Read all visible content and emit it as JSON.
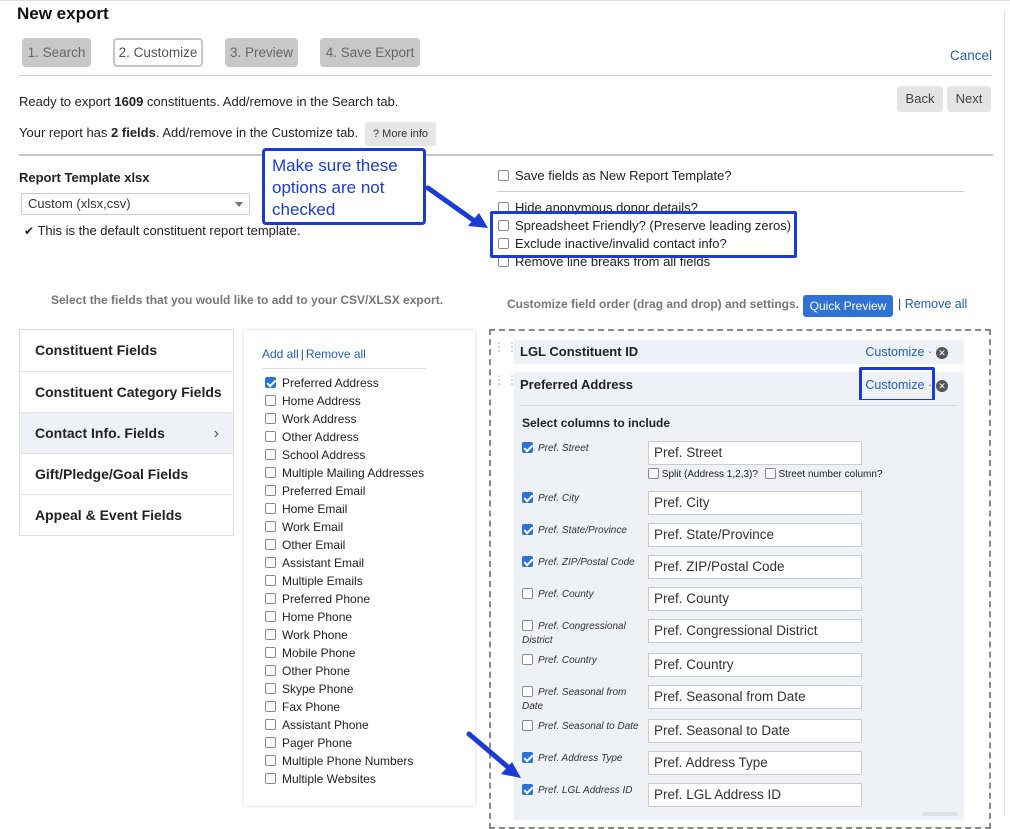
{
  "header": {
    "title": "New export"
  },
  "steps": [
    {
      "label": "1. Search"
    },
    {
      "label": "2. Customize"
    },
    {
      "label": "3. Preview"
    },
    {
      "label": "4. Save Export"
    }
  ],
  "cancel_label": "Cancel",
  "summary": {
    "line1_pre": "Ready to export ",
    "line1_count": "1609",
    "line1_post": " constituents. Add/remove in the Search tab.",
    "line2_pre": "Your report has ",
    "line2_count": "2 fields",
    "line2_post": ". Add/remove in the Customize tab.",
    "more_info": "? More info"
  },
  "nav": {
    "back": "Back",
    "next": "Next"
  },
  "template": {
    "label": "Report Template xlsx",
    "selected": "Custom (xlsx,csv)",
    "default_note": "This is the default constituent report template."
  },
  "options": [
    {
      "label": "Save fields as New Report Template?",
      "checked": false
    },
    {
      "label": "Hide anonymous donor details?",
      "checked": false
    },
    {
      "label": "Spreadsheet Friendly? (Preserve leading zeros)",
      "checked": false
    },
    {
      "label": "Exclude inactive/invalid contact info?",
      "checked": false
    },
    {
      "label": "Remove line breaks from all fields",
      "checked": false
    }
  ],
  "callout_text": "Make sure these options are not checked",
  "left_heading": "Select the fields that you would like to add to your CSV/XLSX export.",
  "right_heading": "Customize field order (drag and drop) and settings.",
  "quick_preview": "Quick Preview",
  "remove_all": "Remove all",
  "categories": [
    {
      "label": "Constituent Fields"
    },
    {
      "label": "Constituent Category Fields"
    },
    {
      "label": "Contact Info. Fields"
    },
    {
      "label": "Gift/Pledge/Goal Fields"
    },
    {
      "label": "Appeal & Event Fields"
    }
  ],
  "field_links": {
    "add_all": "Add all",
    "remove_all": "Remove all"
  },
  "fields": [
    {
      "label": "Preferred Address",
      "checked": true
    },
    {
      "label": "Home Address",
      "checked": false
    },
    {
      "label": "Work Address",
      "checked": false
    },
    {
      "label": "Other Address",
      "checked": false
    },
    {
      "label": "School Address",
      "checked": false
    },
    {
      "label": "Multiple Mailing Addresses",
      "checked": false
    },
    {
      "label": "Preferred Email",
      "checked": false
    },
    {
      "label": "Home Email",
      "checked": false
    },
    {
      "label": "Work Email",
      "checked": false
    },
    {
      "label": "Other Email",
      "checked": false
    },
    {
      "label": "Assistant Email",
      "checked": false
    },
    {
      "label": "Multiple Emails",
      "checked": false
    },
    {
      "label": "Preferred Phone",
      "checked": false
    },
    {
      "label": "Home Phone",
      "checked": false
    },
    {
      "label": "Work Phone",
      "checked": false
    },
    {
      "label": "Mobile Phone",
      "checked": false
    },
    {
      "label": "Other Phone",
      "checked": false
    },
    {
      "label": "Skype Phone",
      "checked": false
    },
    {
      "label": "Fax Phone",
      "checked": false
    },
    {
      "label": "Assistant Phone",
      "checked": false
    },
    {
      "label": "Pager Phone",
      "checked": false
    },
    {
      "label": "Multiple Phone Numbers",
      "checked": false
    },
    {
      "label": "Multiple Websites",
      "checked": false
    }
  ],
  "selected_fields": [
    {
      "title": "LGL Constituent ID",
      "customize": "Customize"
    },
    {
      "title": "Preferred Address",
      "customize": "Customize"
    }
  ],
  "columns_heading": "Select columns to include",
  "split_options": {
    "split": "Split (Address 1,2,3)?",
    "street_number": "Street number column?"
  },
  "columns": [
    {
      "label": "Pref. Street",
      "value": "Pref. Street",
      "checked": true
    },
    {
      "label": "Pref. City",
      "value": "Pref. City",
      "checked": true
    },
    {
      "label": "Pref. State/Province",
      "value": "Pref. State/Province",
      "checked": true
    },
    {
      "label": "Pref. ZIP/Postal Code",
      "value": "Pref. ZIP/Postal Code",
      "checked": true
    },
    {
      "label": "Pref. County",
      "value": "Pref. County",
      "checked": false
    },
    {
      "label": "Pref. Congressional District",
      "value": "Pref. Congressional District",
      "checked": false
    },
    {
      "label": "Pref. Country",
      "value": "Pref. Country",
      "checked": false
    },
    {
      "label": "Pref. Seasonal from Date",
      "value": "Pref. Seasonal from Date",
      "checked": false
    },
    {
      "label": "Pref. Seasonal to Date",
      "value": "Pref. Seasonal to Date",
      "checked": false
    },
    {
      "label": "Pref. Address Type",
      "value": "Pref. Address Type",
      "checked": true
    },
    {
      "label": "Pref. LGL Address ID",
      "value": "Pref. LGL Address ID",
      "checked": true
    }
  ],
  "colors": {
    "link": "#1f5fbf",
    "annotation": "#1a3bd6",
    "button_primary": "#2f72d4",
    "checkbox": "#2a74d6"
  }
}
